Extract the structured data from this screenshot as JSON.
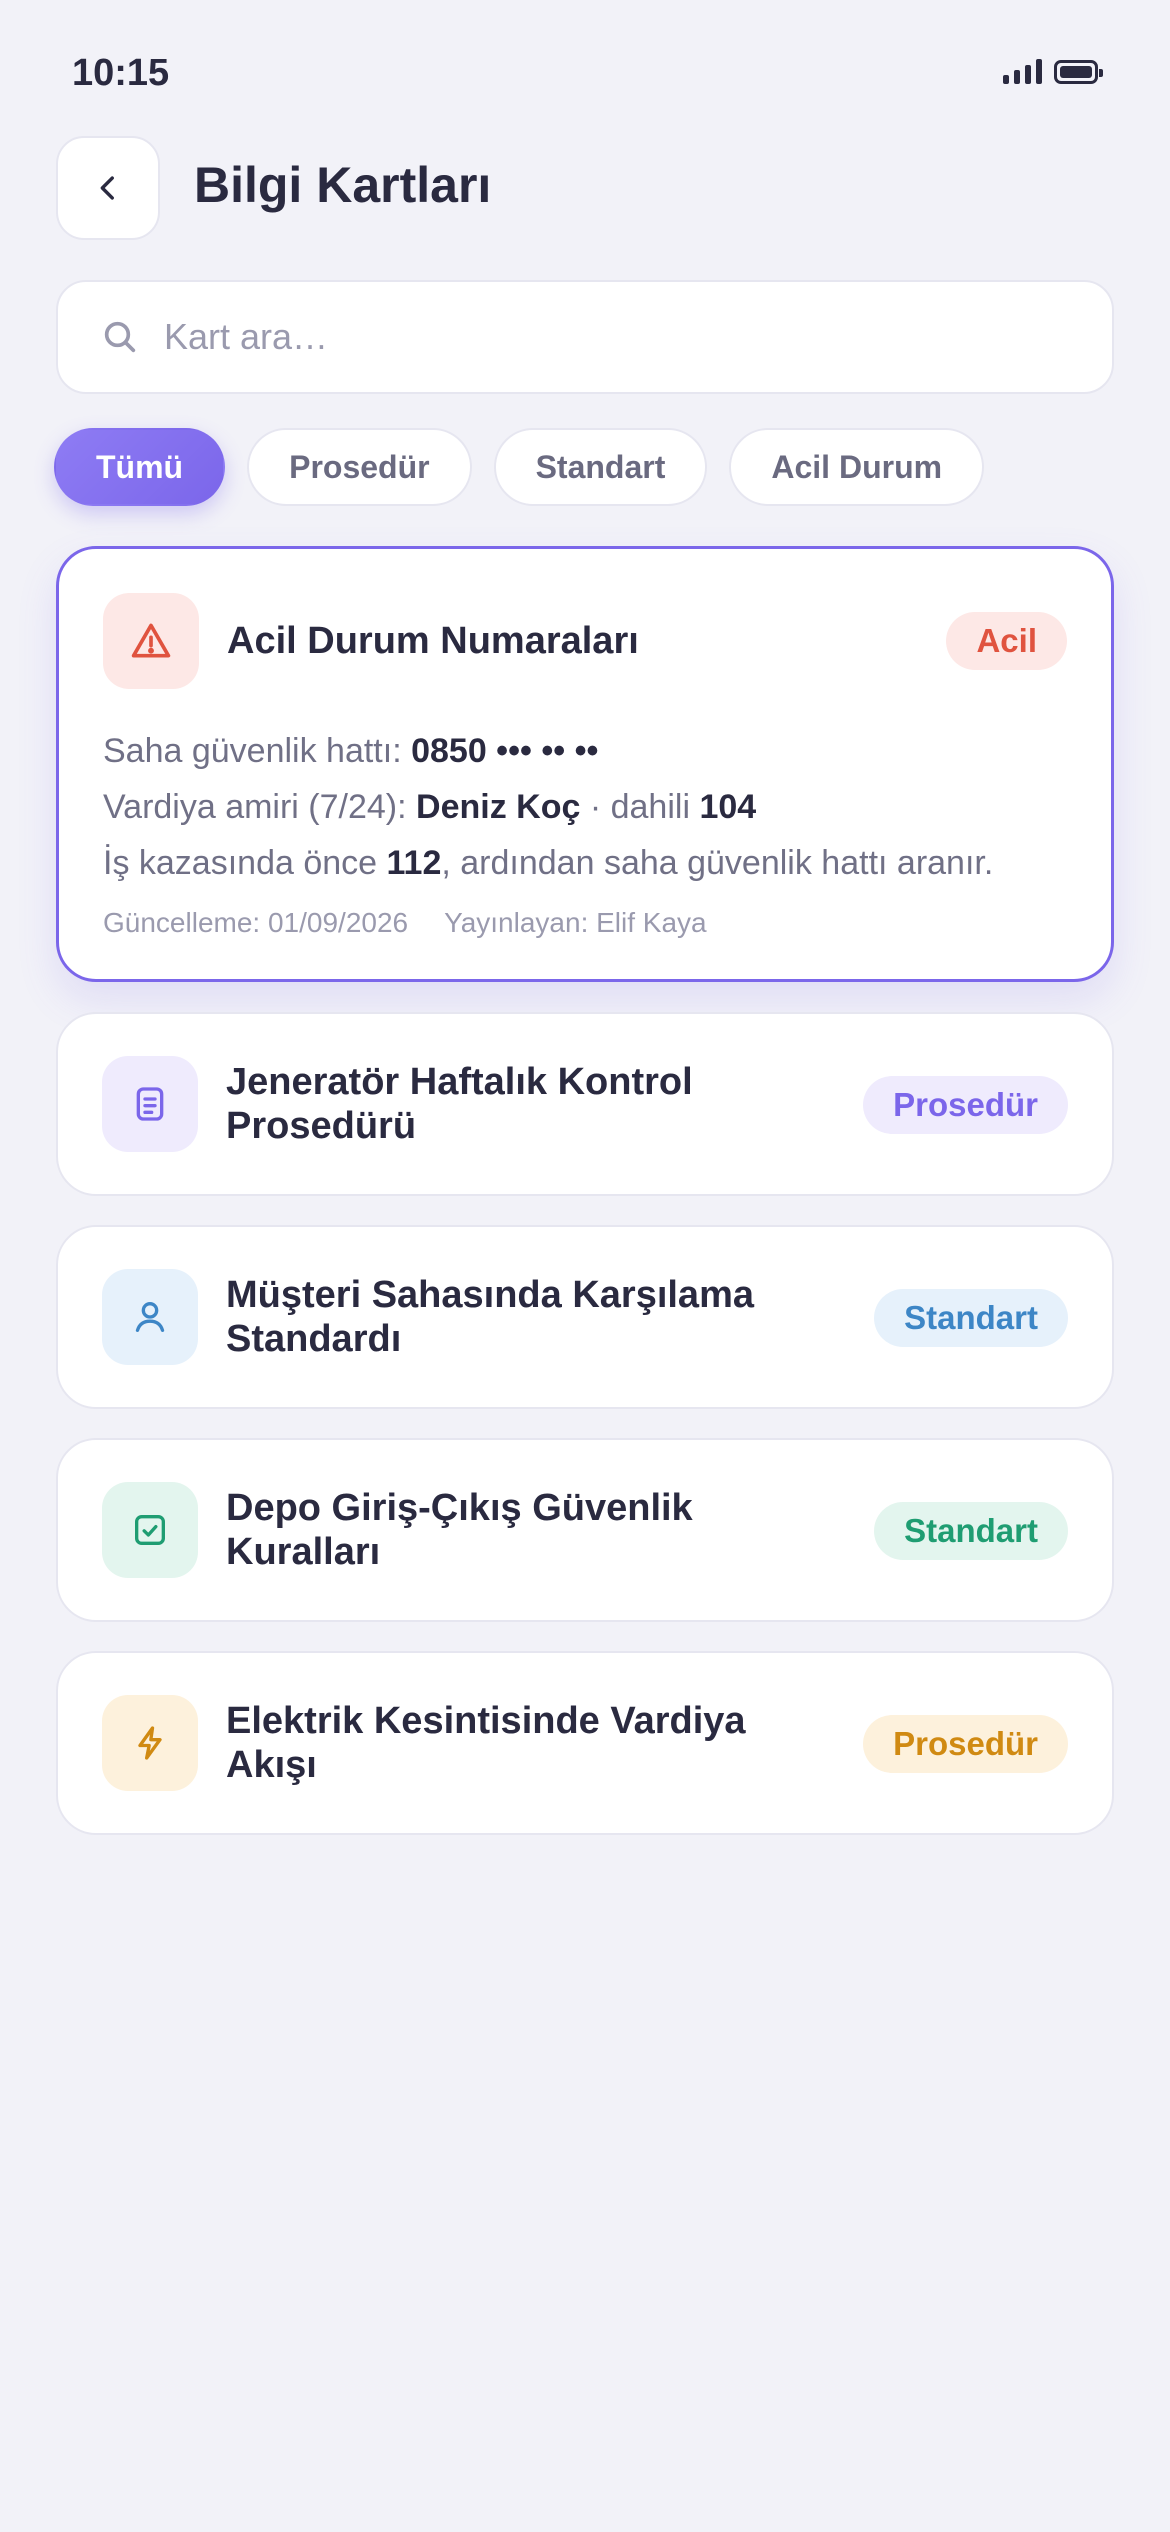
{
  "status_bar": {
    "time": "10:15"
  },
  "header": {
    "title": "Bilgi Kartları"
  },
  "search": {
    "placeholder": "Kart ara…"
  },
  "filters": [
    "Tümü",
    "Prosedür",
    "Standart",
    "Acil Durum"
  ],
  "active_filter": "Tümü",
  "featured_card": {
    "title": "Acil Durum Numaraları",
    "badge": "Acil",
    "icon": "warning-icon",
    "line1": {
      "label": "Saha güvenlik hattı: ",
      "value": "0850 ••• •• ••"
    },
    "line2": {
      "label": "Vardiya amiri (7/24): ",
      "name": "Deniz Koç",
      "ext_label": " · dahili ",
      "ext": "104"
    },
    "line3": {
      "prefix": "İş kazasında önce ",
      "number": "112",
      "suffix": ", ardından saha güvenlik hattı aranır."
    },
    "updated": "Güncelleme: 01/09/2026",
    "publisher": "Yayınlayan: Elif Kaya"
  },
  "cards": [
    {
      "title_line1": "Jeneratör Haftalık Kontrol",
      "title_line2": "Prosedürü",
      "badge": "Prosedür",
      "icon": "document-icon",
      "accent": "#7b66ea"
    },
    {
      "title_line1": "Müşteri Sahasında Karşılama",
      "title_line2": "Standardı",
      "badge": "Standart",
      "icon": "user-icon",
      "accent": "#3d86c6"
    },
    {
      "title_line1": "Depo Giriş-Çıkış Güvenlik",
      "title_line2": "Kuralları",
      "badge": "Standart",
      "icon": "checkbox-icon",
      "accent": "#1f9d72"
    },
    {
      "title_line1": "Elektrik Kesintisinde Vardiya",
      "title_line2": "Akışı",
      "badge": "Prosedür",
      "icon": "lightning-icon",
      "accent": "#d08a12"
    }
  ],
  "colors": {
    "primary": "#7b66ea",
    "danger": "#e0533f",
    "background": "#f2f2f8"
  }
}
